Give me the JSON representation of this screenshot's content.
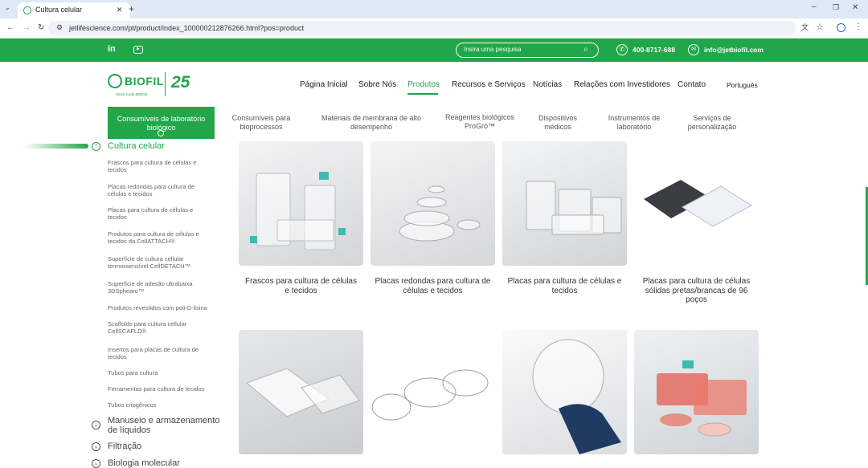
{
  "browser": {
    "tab_title": "Cultura celular",
    "url": "jetlifescience.com/pt/product/index_100000212876266.html?pos=product"
  },
  "topbar": {
    "search_placeholder": "Insira uma pesquisa",
    "phone": "400-8717-688",
    "email": "info@jetbiofil.com"
  },
  "header": {
    "logo_text": "BIOFIL",
    "logo_sub": "Stock Code 688026",
    "anniversary": "25",
    "nav": [
      "Página Inicial",
      "Sobre Nós",
      "Produtos",
      "Recursos e Serviços",
      "Notícias",
      "Relações com Investidores",
      "Contato"
    ],
    "language": "Português"
  },
  "categories": [
    {
      "line1": "Consumíveis de laboratório",
      "line2": "biológico"
    },
    {
      "line1": "Consumíveis para",
      "line2": "bioprocessos"
    },
    {
      "line1": "Materiais de membrana de alto",
      "line2": "desempenho"
    },
    {
      "line1": "Reagentes biológicos",
      "line2": "ProGro™"
    },
    {
      "line1": "Dispositivos",
      "line2": "médicos"
    },
    {
      "line1": "Instrumentos de",
      "line2": "laboratório"
    },
    {
      "line1": "Serviços de",
      "line2": "personalização"
    }
  ],
  "sidebar": {
    "active_heading": "Cultura celular",
    "items": [
      {
        "l1": "Frascos para cultura de células e",
        "l2": "tecidos"
      },
      {
        "l1": "Placas redondas para cultura de",
        "l2": "células e tecidos"
      },
      {
        "l1": "Placas para cultura de células e",
        "l2": "tecidos"
      },
      {
        "l1": "Produtos para cultura de células e",
        "l2": "tecidos da CellATTACH®"
      },
      {
        "l1": "Superfície de cultura cellular",
        "l2": "termossensível CellDETACH™"
      },
      {
        "l1": "Superfície de adesão ultrabaixa",
        "l2": "3DSphearo™"
      },
      {
        "l1": "Produtos revestidos com poli-D-lisina",
        "l2": ""
      },
      {
        "l1": "Scaffolds para cultura cellular",
        "l2": "CellSCAFLD®"
      },
      {
        "l1": "Insertos para placas de cultura de",
        "l2": "tecidos"
      },
      {
        "l1": "Tubos para cultura",
        "l2": ""
      },
      {
        "l1": "Ferramentas para cultura de tecidos",
        "l2": ""
      },
      {
        "l1": "Tubos criogênicos",
        "l2": ""
      }
    ],
    "other_headings": [
      {
        "l1": "Manuseio e armazenamento",
        "l2": "de líquidos"
      },
      {
        "l1": "Filtração",
        "l2": ""
      },
      {
        "l1": "Biologia molecular",
        "l2": ""
      }
    ]
  },
  "products": [
    {
      "l1": "Frascos para cultura de células",
      "l2": "e tecidos",
      "l3": ""
    },
    {
      "l1": "Placas redondas para cultura de",
      "l2": "células e tecidos",
      "l3": ""
    },
    {
      "l1": "Placas para cultura de células e",
      "l2": "tecidos",
      "l3": ""
    },
    {
      "l1": "Placas para cultura de células",
      "l2": "sólidas pretas/brancas de 96",
      "l3": "poços"
    },
    {
      "l1": "",
      "l2": "",
      "l3": ""
    },
    {
      "l1": "",
      "l2": "",
      "l3": ""
    },
    {
      "l1": "",
      "l2": "",
      "l3": ""
    },
    {
      "l1": "",
      "l2": "",
      "l3": ""
    }
  ],
  "colors": {
    "brand_green": "#21a64a"
  }
}
